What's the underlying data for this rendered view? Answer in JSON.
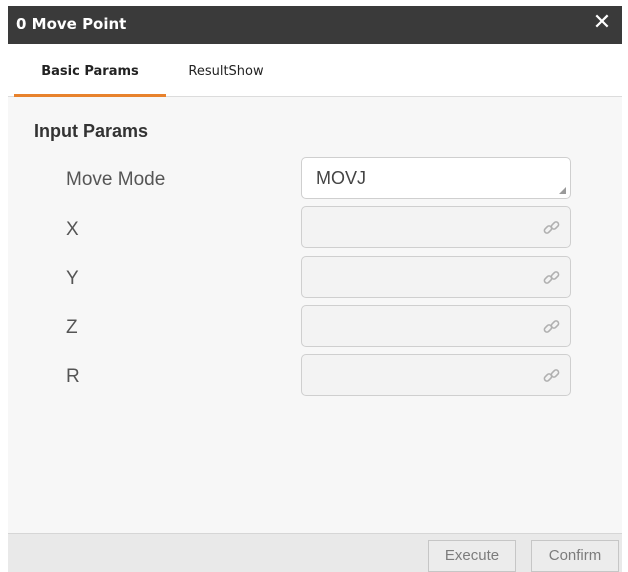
{
  "dialog": {
    "title": "0 Move Point",
    "close_icon": "close-icon"
  },
  "tabs": [
    {
      "label": "Basic Params",
      "active": true
    },
    {
      "label": "ResultShow",
      "active": false
    }
  ],
  "section": {
    "title": "Input Params"
  },
  "params": [
    {
      "label": "Move Mode",
      "value": "MOVJ",
      "type": "select"
    },
    {
      "label": "X",
      "value": "",
      "type": "input",
      "icon": "link-icon"
    },
    {
      "label": "Y",
      "value": "",
      "type": "input",
      "icon": "link-icon"
    },
    {
      "label": "Z",
      "value": "",
      "type": "input",
      "icon": "link-icon"
    },
    {
      "label": "R",
      "value": "",
      "type": "input",
      "icon": "link-icon"
    }
  ],
  "footer": {
    "execute_label": "Execute",
    "confirm_label": "Confirm"
  },
  "colors": {
    "titlebar": "#3a3a3a",
    "accent": "#e8822c"
  }
}
